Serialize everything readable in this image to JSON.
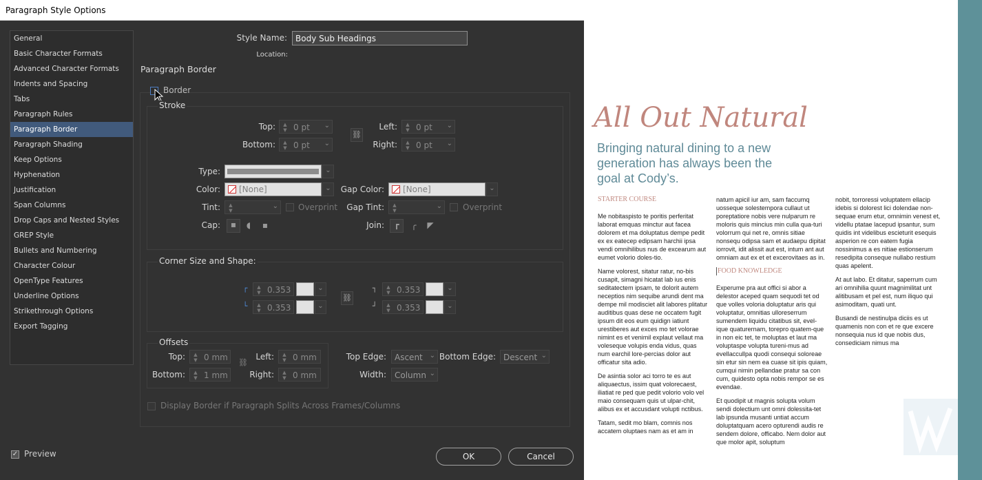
{
  "dialog": {
    "title": "Paragraph Style Options",
    "style_name_label": "Style Name:",
    "style_name_value": "Body Sub Headings",
    "location_label": "Location:",
    "section_title": "Paragraph Border",
    "nav": [
      "General",
      "Basic Character Formats",
      "Advanced Character Formats",
      "Indents and Spacing",
      "Tabs",
      "Paragraph Rules",
      "Paragraph Border",
      "Paragraph Shading",
      "Keep Options",
      "Hyphenation",
      "Justification",
      "Span Columns",
      "Drop Caps and Nested Styles",
      "GREP Style",
      "Bullets and Numbering",
      "Character Colour",
      "OpenType Features",
      "Underline Options",
      "Strikethrough Options",
      "Export Tagging"
    ],
    "selected_nav": "Paragraph Border",
    "border_label": "Border",
    "border_checked": false,
    "stroke": {
      "label": "Stroke",
      "top_label": "Top:",
      "top_value": "0 pt",
      "bottom_label": "Bottom:",
      "bottom_value": "0 pt",
      "left_label": "Left:",
      "left_value": "0 pt",
      "right_label": "Right:",
      "right_value": "0 pt",
      "type_label": "Type:",
      "color_label": "Color:",
      "color_value": "[None]",
      "gap_color_label": "Gap Color:",
      "gap_color_value": "[None]",
      "tint_label": "Tint:",
      "gap_tint_label": "Gap Tint:",
      "overprint_label": "Overprint",
      "gap_overprint_label": "Overprint",
      "cap_label": "Cap:",
      "join_label": "Join:"
    },
    "corner": {
      "label": "Corner Size and Shape:",
      "top_left": "0.353",
      "bottom_left": "0.353",
      "top_right": "0.353",
      "bottom_right": "0.353"
    },
    "offsets": {
      "label": "Offsets",
      "top_label": "Top:",
      "top_value": "0 mm",
      "bottom_label": "Bottom:",
      "bottom_value": "1 mm",
      "left_label": "Left:",
      "left_value": "0 mm",
      "right_label": "Right:",
      "right_value": "0 mm",
      "top_edge_label": "Top Edge:",
      "top_edge_value": "Ascent",
      "bottom_edge_label": "Bottom Edge:",
      "bottom_edge_value": "Descent",
      "width_label": "Width:",
      "width_value": "Column"
    },
    "display_border_label": "Display Border if Paragraph Splits Across Frames/Columns",
    "preview_label": "Preview",
    "preview_checked": true,
    "ok_label": "OK",
    "cancel_label": "Cancel"
  },
  "document": {
    "headline": "All Out Natural",
    "subhead": "Bringing natural dining to a new generation has always been the goal at Cody’s.",
    "col1_head": "STARTER COURSE",
    "col1_p1": "Me nobitaspisto te poritis perferitat laborat emquas minctur aut facea dolorem et ma doluptatus dempe pedit ex ex eatecep edipsam harchii ipsa vendi omnihilibus nus de excearum aut eumet volorio doles-tio.",
    "col1_p2": "Name volorest, sitatur ratur, no-bis cusapit, simagni hicatat lab ius enis seditatectem ipsam, te dolorit autem neceptios nim sequibe arundi dent ma dempe mil modisciet alit labores plitatur auditibus quas dese ne occatem fugit ipsum dit eos eum quidign iatiunt urestiberes aut exces mo tet volorae nimint es et venimil explaut vellaut ma voleseque volupis enda vidus, quas num earchil lore-percias dolor aut officatur sita adio.",
    "col1_p3": "De asintia solor aci torro te es aut aliquaectus, issim quat volorecaest, iliatiat re ped que pedit volorio volo vel maio consequam quis ut ulpar-chit, alibus ex et accusdant volupti nctibus.",
    "col1_p4": "Tatam, sedit mo blam, comnis nos accatem oluptaes nam as et am in",
    "col2_p1": "natum apicil iur am, sam faccumq uosseque solestempora cullaut ut poreptatiore nobis vere nulparum re moloris quis mincius min culla qua-turi volorrum qui net re, omnis sitiae nonsequ odipsa sam et audaepu dipitat iorrovit, idit alissit aut est, intum ant aut omniam aut ex et et excerovitaes as in.",
    "col2_head": "FOOD KNOWLEDGE",
    "col2_p2": "Experume pra aut offici si abor a delestor aceped quam sequodi tet od que volles voloria doluptatur aris qui voluptatur, omnitias ulloreserrum sumendem liquidu citatibus sit, evel-ique quaturernam, torepro quatem-que in non eic tet, te moluptas et laut ma voluptaspe volupta tureni-mus ad evellaccullpa quodi consequi soloreae sin etur sin nem ea cuase sit ipis quiam, cumqui nimin pellandae pratur sa con cum, quidesto opta nobis rempor se es evendae.",
    "col2_p3": "Et quodipit ut magnis solupta volum sendi dolectium unt omni dolessita-tet lab ipsunda musanti untiat accum doluptatquam acero opturendi audis re sendem dolore, officabo. Nem dolor aut que molor apit, soluptum",
    "col3_p1": "nobit, torroressi voluptatem ellacip idebis si dolorest lici dolendae non-sequae erum etur, omnimin venest et, videllu ptatae lacepud ipsantur, sum quidis int videlibus escieturit esequis asperion re con eatem fugia nossinimus a es nitiae estionserum resedipita conseque nullabo restium quas apelent.",
    "col3_p2": "At aut labo. Et ditatur, saperrum cum ari omnihilia quunt magnimilitat unt alitibusam et pel est, num iliquo qui asimoditam, quati unt.",
    "col3_p3": "Busandi de nestinulpa diciis es ut quamenis non con et re que excere nonsequia nus id que nobis dus, consediciam nimus ma"
  },
  "colors": {
    "teal": "#5e9199",
    "headline": "#c0867d",
    "subhead": "#5f8a97",
    "selection": "#415a7c"
  }
}
